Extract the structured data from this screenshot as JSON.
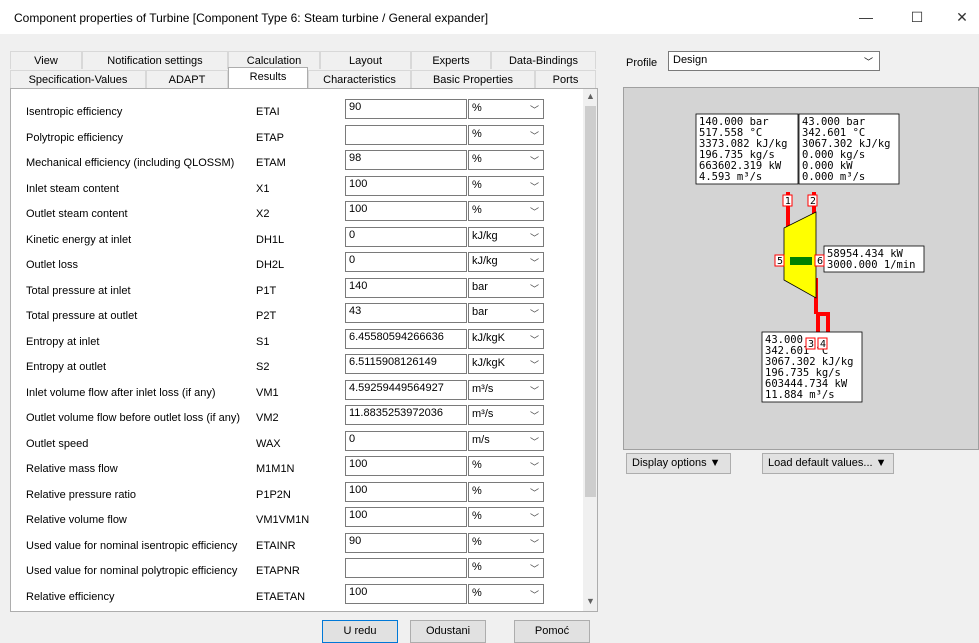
{
  "window": {
    "title": "Component properties of Turbine   [Component Type 6: Steam turbine / General expander]",
    "minimize": "—",
    "maximize": "☐",
    "close": "✕"
  },
  "tabs": {
    "row1": [
      "View",
      "Notification settings",
      "Calculation",
      "Layout",
      "Experts",
      "Data-Bindings"
    ],
    "row2": [
      "Specification-Values",
      "ADAPT",
      "Results",
      "Characteristics",
      "Basic Properties",
      "Ports"
    ],
    "active": "Results"
  },
  "rows": [
    {
      "label": "Isentropic efficiency",
      "code": "ETAI",
      "value": "90",
      "unit": "%"
    },
    {
      "label": "Polytropic efficiency",
      "code": "ETAP",
      "value": "",
      "unit": "%"
    },
    {
      "label": "Mechanical efficiency (including QLOSSM)",
      "code": "ETAM",
      "value": "98",
      "unit": "%"
    },
    {
      "label": "Inlet steam content",
      "code": "X1",
      "value": "100",
      "unit": "%"
    },
    {
      "label": "Outlet steam content",
      "code": "X2",
      "value": "100",
      "unit": "%"
    },
    {
      "label": "Kinetic energy at inlet",
      "code": "DH1L",
      "value": "0",
      "unit": "kJ/kg"
    },
    {
      "label": "Outlet loss",
      "code": "DH2L",
      "value": "0",
      "unit": "kJ/kg"
    },
    {
      "label": "Total pressure at inlet",
      "code": "P1T",
      "value": "140",
      "unit": "bar"
    },
    {
      "label": "Total pressure at outlet",
      "code": "P2T",
      "value": "43",
      "unit": "bar"
    },
    {
      "label": "Entropy at inlet",
      "code": "S1",
      "value": "6.45580594266636",
      "unit": "kJ/kgK"
    },
    {
      "label": "Entropy at outlet",
      "code": "S2",
      "value": "6.5115908126149",
      "unit": "kJ/kgK"
    },
    {
      "label": "Inlet volume flow after inlet loss (if any)",
      "code": "VM1",
      "value": "4.59259449564927",
      "unit": "m³/s"
    },
    {
      "label": "Outlet volume flow before outlet loss (if any)",
      "code": "VM2",
      "value": "11.8835253972036",
      "unit": "m³/s"
    },
    {
      "label": "Outlet speed",
      "code": "WAX",
      "value": "0",
      "unit": "m/s"
    },
    {
      "label": "Relative mass flow",
      "code": "M1M1N",
      "value": "100",
      "unit": "%"
    },
    {
      "label": "Relative pressure ratio",
      "code": "P1P2N",
      "value": "100",
      "unit": "%"
    },
    {
      "label": "Relative volume flow",
      "code": "VM1VM1N",
      "value": "100",
      "unit": "%"
    },
    {
      "label": "Used value for nominal isentropic efficiency",
      "code": "ETAINR",
      "value": "90",
      "unit": "%"
    },
    {
      "label": "Used value for nominal polytropic efficiency",
      "code": "ETAPNR",
      "value": "",
      "unit": "%"
    },
    {
      "label": "Relative efficiency",
      "code": "ETAETAN",
      "value": "100",
      "unit": "%"
    }
  ],
  "buttons": {
    "ok": "U redu",
    "cancel": "Odustani",
    "help": "Pomoć"
  },
  "profile": {
    "label": "Profile",
    "value": "Design"
  },
  "diagram": {
    "inlet_box": [
      "140.000 bar",
      "517.558 °C",
      "3373.082 kJ/kg",
      "196.735 kg/s",
      "663602.319 kW",
      "4.593 m³/s"
    ],
    "outlet2_box": [
      "43.000 bar",
      "342.601 °C",
      "3067.302 kJ/kg",
      "0.000 kg/s",
      "0.000 kW",
      "0.000 m³/s"
    ],
    "shaft_box": [
      "58954.434 kW",
      "3000.000 1/min"
    ],
    "outlet_box": [
      "43.000",
      "342.601 °C",
      "3067.302 kJ/kg",
      "196.735 kg/s",
      "603444.734 kW",
      "11.884 m³/s"
    ],
    "ports": [
      "1",
      "2",
      "3",
      "4",
      "5",
      "6"
    ],
    "colors": {
      "pipe": "#ff0000",
      "turbine": "#ffff00",
      "shaft": "#008000",
      "box": "#ffffff"
    }
  },
  "display_options": "Display options",
  "load_defaults": "Load default values..."
}
